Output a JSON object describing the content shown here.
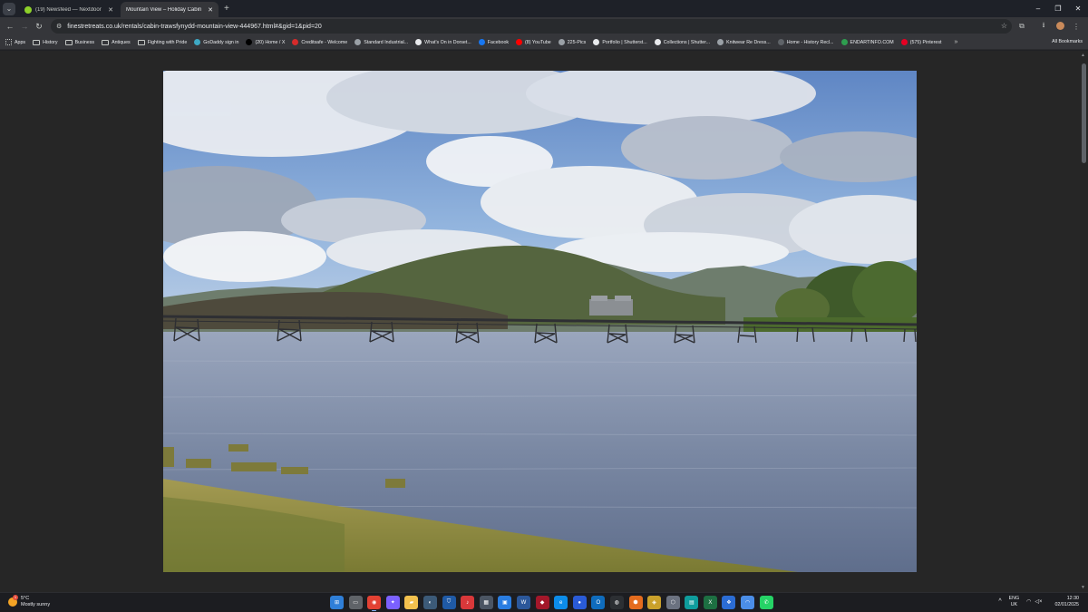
{
  "tabs": [
    {
      "title": "(19) Newsfeed — Nextdoor",
      "favicon_color": "#8ed12a",
      "active": false
    },
    {
      "title": "Mountain View – Holiday Cabin",
      "favicon_color": "#5f6368",
      "active": true
    }
  ],
  "window_controls": {
    "minimize": "–",
    "restore": "❐",
    "close": "✕"
  },
  "toolbar": {
    "url": "finestretreats.co.uk/rentals/cabin-trawsfynydd-mountain-view-444967.html#&gid=1&pid=20",
    "back": "←",
    "forward": "→",
    "reload": "↻",
    "star": "☆",
    "extensions": "⧉",
    "download": "⭳",
    "menu": "⋮"
  },
  "bookmarks": [
    {
      "label": "Apps",
      "type": "grid",
      "color": "#c4c7c5"
    },
    {
      "label": "History",
      "type": "folder",
      "color": "#c4c7c5"
    },
    {
      "label": "Business",
      "type": "folder",
      "color": "#c4c7c5"
    },
    {
      "label": "Antiques",
      "type": "folder",
      "color": "#c4c7c5"
    },
    {
      "label": "Fighting with Pride",
      "type": "folder",
      "color": "#c4c7c5"
    },
    {
      "label": "GoDaddy sign in",
      "type": "site",
      "color": "#3ea9c4"
    },
    {
      "label": "(20) Home / X",
      "type": "site",
      "color": "#000000"
    },
    {
      "label": "Creditsafe - Welcome",
      "type": "site",
      "color": "#d62b2b"
    },
    {
      "label": "Standard Industrial...",
      "type": "site",
      "color": "#9aa0a6"
    },
    {
      "label": "What's On in Dorset...",
      "type": "site",
      "color": "#e8eaed"
    },
    {
      "label": "Facebook",
      "type": "site",
      "color": "#1877f2"
    },
    {
      "label": "(8) YouTube",
      "type": "site",
      "color": "#ff0000"
    },
    {
      "label": "225-Pics",
      "type": "site",
      "color": "#9aa0a6"
    },
    {
      "label": "Portfolio | Shutterst...",
      "type": "site",
      "color": "#e8eaed"
    },
    {
      "label": "Collections | Shutter...",
      "type": "site",
      "color": "#e8eaed"
    },
    {
      "label": "Knitwear Re Dress...",
      "type": "site",
      "color": "#9aa0a6"
    },
    {
      "label": "Home - History Recl...",
      "type": "site",
      "color": "#5f6368"
    },
    {
      "label": "ENDARTINFO.COM",
      "type": "site",
      "color": "#2e9d4f"
    },
    {
      "label": "(575) Pinterest",
      "type": "site",
      "color": "#e60023"
    }
  ],
  "bookmarks_more": "»",
  "all_bookmarks": "All Bookmarks",
  "weather": {
    "temp": "5°C",
    "condition": "Mostly sunny",
    "badge": "1"
  },
  "taskbar_apps": [
    {
      "icon": "windows-start-icon",
      "color": "#2f7fd8",
      "glyph": "⊞"
    },
    {
      "icon": "task-view-icon",
      "color": "#5f6368",
      "glyph": "▭"
    },
    {
      "icon": "chrome-icon",
      "color": "#e34133",
      "glyph": "◉",
      "active": true
    },
    {
      "icon": "copilot-icon",
      "color": "#7b61ff",
      "glyph": "✦"
    },
    {
      "icon": "file-explorer-icon",
      "color": "#f2c14e",
      "glyph": "▰"
    },
    {
      "icon": "steam-icon",
      "color": "#3c5a78",
      "glyph": "◐"
    },
    {
      "icon": "shield-icon",
      "color": "#1f5aa6",
      "glyph": "⛉"
    },
    {
      "icon": "music-app-icon",
      "color": "#d9383a",
      "glyph": "♪"
    },
    {
      "icon": "calculator-icon",
      "color": "#4b5563",
      "glyph": "▦"
    },
    {
      "icon": "photos-icon",
      "color": "#2a7de1",
      "glyph": "▣"
    },
    {
      "icon": "word-icon",
      "color": "#2b579a",
      "glyph": "W"
    },
    {
      "icon": "app-red-icon",
      "color": "#a3172a",
      "glyph": "◆"
    },
    {
      "icon": "edge-icon",
      "color": "#0c8ce9",
      "glyph": "e"
    },
    {
      "icon": "app-blue-icon",
      "color": "#2a5bd7",
      "glyph": "●"
    },
    {
      "icon": "outlook-icon",
      "color": "#0f6cbd",
      "glyph": "O"
    },
    {
      "icon": "app-dark-icon",
      "color": "#2c2f33",
      "glyph": "◍"
    },
    {
      "icon": "app-orange-icon",
      "color": "#e46c1e",
      "glyph": "⬢"
    },
    {
      "icon": "app-yellow-icon",
      "color": "#caa12b",
      "glyph": "◈"
    },
    {
      "icon": "app-gray-icon",
      "color": "#6b7280",
      "glyph": "⬡"
    },
    {
      "icon": "app-teal-icon",
      "color": "#0f9d9d",
      "glyph": "▤"
    },
    {
      "icon": "excel-icon",
      "color": "#1d6f42",
      "glyph": "X"
    },
    {
      "icon": "windows-app-icon",
      "color": "#2b6cd4",
      "glyph": "❖"
    },
    {
      "icon": "app-lightblue-icon",
      "color": "#4b8ee8",
      "glyph": "◠"
    },
    {
      "icon": "whatsapp-icon",
      "color": "#25d366",
      "glyph": "✆"
    }
  ],
  "tray": {
    "chevron": "^",
    "lang_line1": "ENG",
    "lang_line2": "UK",
    "wifi": "wifi-icon",
    "volume": "volume-icon",
    "time": "12:30",
    "date": "02/01/2025"
  },
  "photo": {
    "description_colors": {
      "sky": "#7fa8d9",
      "water": "#7d8aa4",
      "grass": "#8d8a3f",
      "hill": "#4f5e3f"
    }
  }
}
